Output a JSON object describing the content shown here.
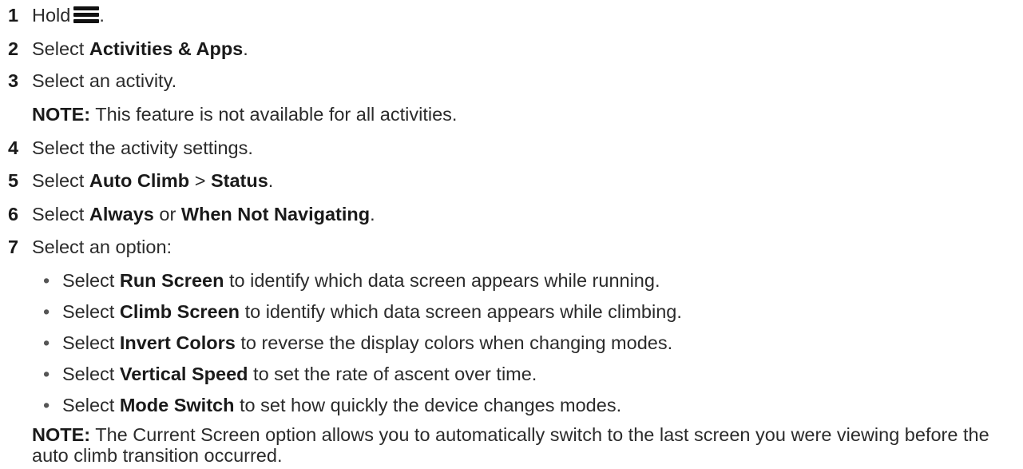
{
  "steps": [
    {
      "num": "1",
      "pre": "Hold",
      "icon": "menu-icon",
      "post": "."
    },
    {
      "num": "2",
      "pre": "Select ",
      "bold": "Activities & Apps",
      "post": "."
    },
    {
      "num": "3",
      "text": "Select an activity."
    },
    {
      "note_label": "NOTE:",
      "note_text": " This feature is not available for all activities."
    },
    {
      "num": "4",
      "text": "Select the activity settings."
    },
    {
      "num": "5",
      "pre": "Select ",
      "bold": "Auto Climb",
      "mid": " > ",
      "bold2": "Status",
      "post": "."
    },
    {
      "num": "6",
      "pre": "Select ",
      "bold": "Always",
      "mid": " or ",
      "bold2": "When Not Navigating",
      "post": "."
    },
    {
      "num": "7",
      "text": "Select an option:"
    }
  ],
  "options": [
    {
      "pre": "Select ",
      "bold": "Run Screen",
      "post": " to identify which data screen appears while running."
    },
    {
      "pre": "Select ",
      "bold": "Climb Screen",
      "post": " to identify which data screen appears while climbing."
    },
    {
      "pre": "Select ",
      "bold": "Invert Colors",
      "post": " to reverse the display colors when changing modes."
    },
    {
      "pre": "Select ",
      "bold": "Vertical Speed",
      "post": " to set the rate of ascent over time."
    },
    {
      "pre": "Select ",
      "bold": "Mode Switch",
      "post": " to set how quickly the device changes modes."
    }
  ],
  "final_note": {
    "label": "NOTE:",
    "text": " The Current Screen option allows you to automatically switch to the last screen you were viewing before the auto climb transition occurred."
  },
  "bullet_char": "•"
}
